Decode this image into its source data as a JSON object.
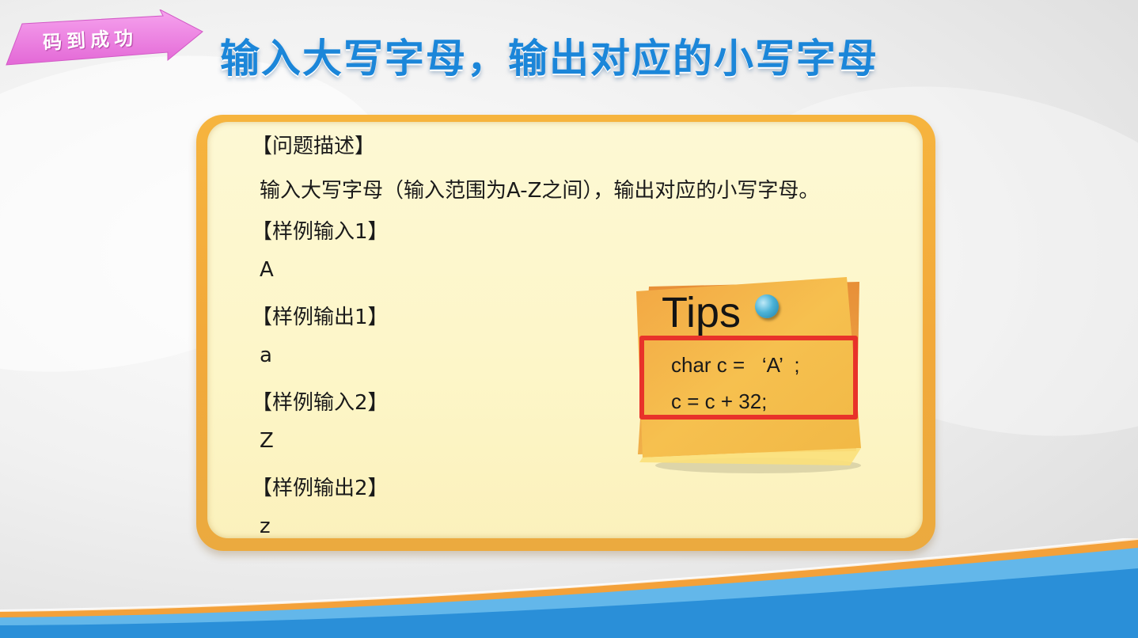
{
  "tag": {
    "label": "码到成功"
  },
  "title": "输入大写字母，输出对应的小写字母",
  "problem": {
    "lines": [
      "【问题描述】",
      "输入大写字母（输入范围为A-Z之间），输出对应的小写字母。",
      "【样例输入1】",
      "A",
      "【样例输出1】",
      "a",
      "【样例输入2】",
      "Z",
      "【样例输出2】",
      "z"
    ]
  },
  "tips": {
    "title": "Tips",
    "code": [
      "char c =   ‘A’  ;",
      "c = c + 32;"
    ]
  },
  "colors": {
    "title": "#1b86d9",
    "tag": "#ee7fdf",
    "card_border": "#f2a93a",
    "card_fill": "#fdf6c8",
    "highlight": "#e8322a",
    "wave_orange": "#f3a13a",
    "wave_blue": "#2a8fd8"
  }
}
